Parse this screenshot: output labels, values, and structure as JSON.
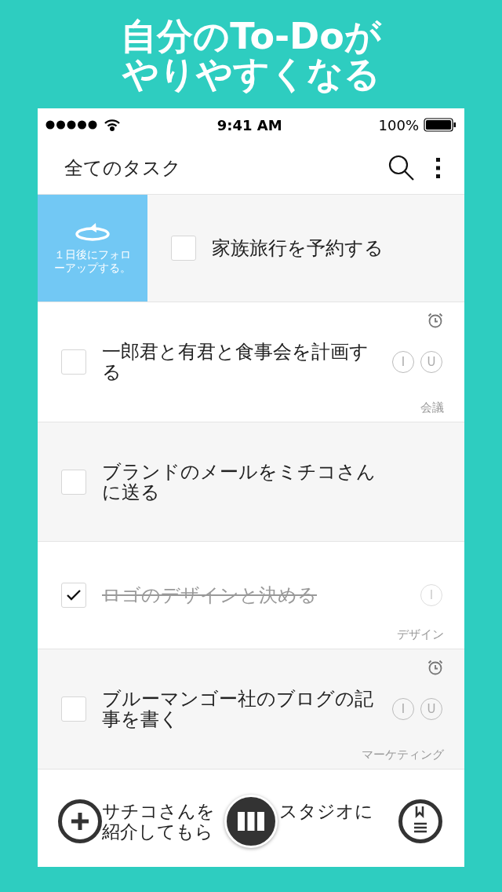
{
  "headline": [
    "自分のTo-Doが",
    "やりやすくなる"
  ],
  "status_bar": {
    "time": "9:41 AM",
    "battery": "100%"
  },
  "app_bar": {
    "title": "全てのタスク"
  },
  "swipe_action": {
    "label": "１日後にフォローアップする。"
  },
  "tasks": [
    {
      "kind": "swiped",
      "title": "家族旅行を予約する",
      "checked": false,
      "alarm": false
    },
    {
      "kind": "normal",
      "title": "一郎君と有君と食事会を計画する",
      "checked": false,
      "alarm": true,
      "badges": [
        "I",
        "U"
      ],
      "tag": "会議"
    },
    {
      "kind": "normal",
      "title": "ブランドのメールをミチコさんに送る",
      "checked": false,
      "alarm": false
    },
    {
      "kind": "normal",
      "title": "ロゴのデザインと決める",
      "checked": true,
      "alarm": false,
      "badges": [
        "I"
      ],
      "tag": "デザイン"
    },
    {
      "kind": "normal",
      "title": "ブルーマンゴー社のブログの記事を書く",
      "checked": false,
      "alarm": true,
      "badges": [
        "I",
        "U"
      ],
      "tag": "マーケティング"
    },
    {
      "kind": "covered",
      "title_parts": [
        "サチコさんを",
        "スタジオに",
        "紹介してもら"
      ]
    }
  ]
}
